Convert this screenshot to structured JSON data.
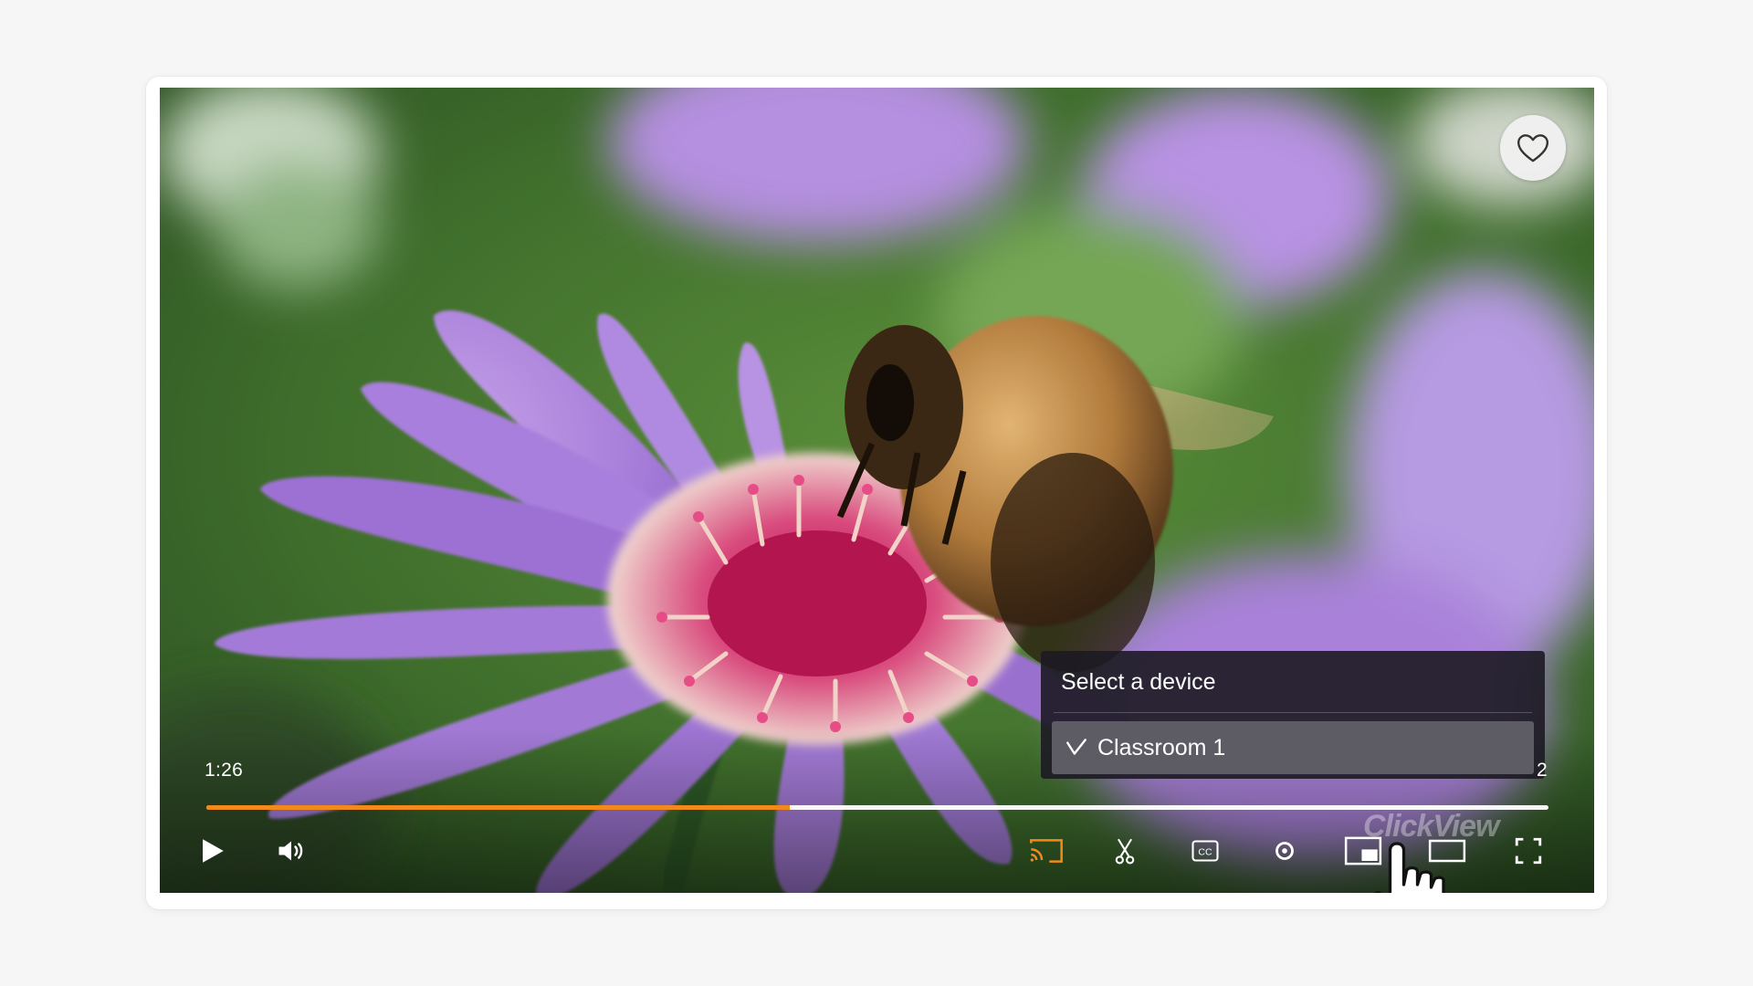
{
  "player": {
    "current_time": "1:26",
    "duration_partial": "2",
    "progress_percent": 43.5,
    "watermark": "ClickView",
    "accent_color": "#f28a1b"
  },
  "device_menu": {
    "title": "Select a device",
    "options": [
      {
        "label": "Classroom 1",
        "selected": true
      }
    ]
  },
  "controls": {
    "left": [
      "play-icon",
      "volume-icon"
    ],
    "right": [
      "cast-icon",
      "clip-scissors-icon",
      "closed-captions-icon",
      "settings-icon",
      "picture-in-picture-icon",
      "theater-mode-icon",
      "fullscreen-icon"
    ]
  },
  "cursor": "hand-pointer-icon"
}
